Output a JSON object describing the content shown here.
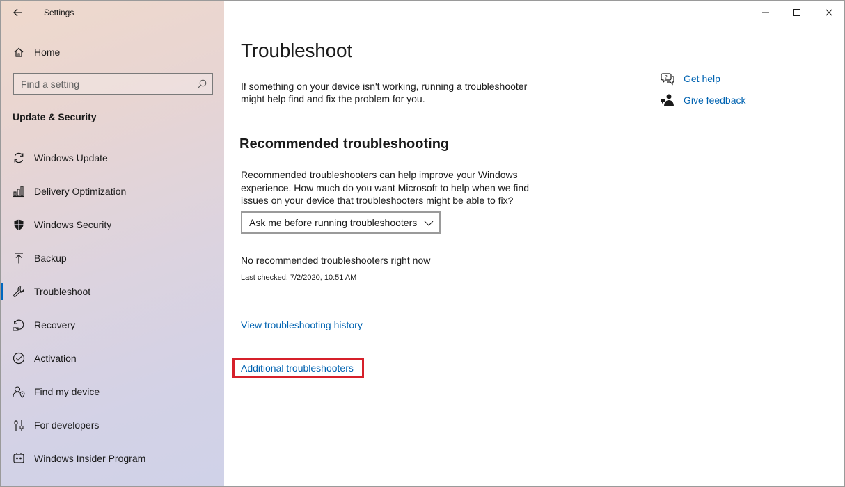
{
  "window": {
    "title": "Settings"
  },
  "sidebar": {
    "home_label": "Home",
    "search_placeholder": "Find a setting",
    "section_heading": "Update & Security",
    "items": [
      {
        "label": "Windows Update",
        "icon": "refresh-icon"
      },
      {
        "label": "Delivery Optimization",
        "icon": "delivery-icon"
      },
      {
        "label": "Windows Security",
        "icon": "shield-icon"
      },
      {
        "label": "Backup",
        "icon": "backup-arrow-icon"
      },
      {
        "label": "Troubleshoot",
        "icon": "wrench-icon",
        "selected": true
      },
      {
        "label": "Recovery",
        "icon": "recovery-icon"
      },
      {
        "label": "Activation",
        "icon": "check-circle-icon"
      },
      {
        "label": "Find my device",
        "icon": "person-location-icon"
      },
      {
        "label": "For developers",
        "icon": "developer-icon"
      },
      {
        "label": "Windows Insider Program",
        "icon": "insider-icon"
      }
    ]
  },
  "main": {
    "title": "Troubleshoot",
    "intro": "If something on your device isn't working, running a troubleshooter might help find and fix the problem for you.",
    "recommended_heading": "Recommended troubleshooting",
    "recommended_description": "Recommended troubleshooters can help improve your Windows experience. How much do you want Microsoft to help when we find issues on your device that troubleshooters might be able to fix?",
    "dropdown_value": "Ask me before running troubleshooters",
    "status": "No recommended troubleshooters right now",
    "last_checked": "Last checked: 7/2/2020, 10:51 AM",
    "history_link": "View troubleshooting history",
    "additional_link": "Additional troubleshooters",
    "help": {
      "get_help": "Get help",
      "give_feedback": "Give feedback"
    }
  },
  "colors": {
    "accent": "#0067c0",
    "link": "#0063b1",
    "highlight_border": "#d6202a"
  }
}
